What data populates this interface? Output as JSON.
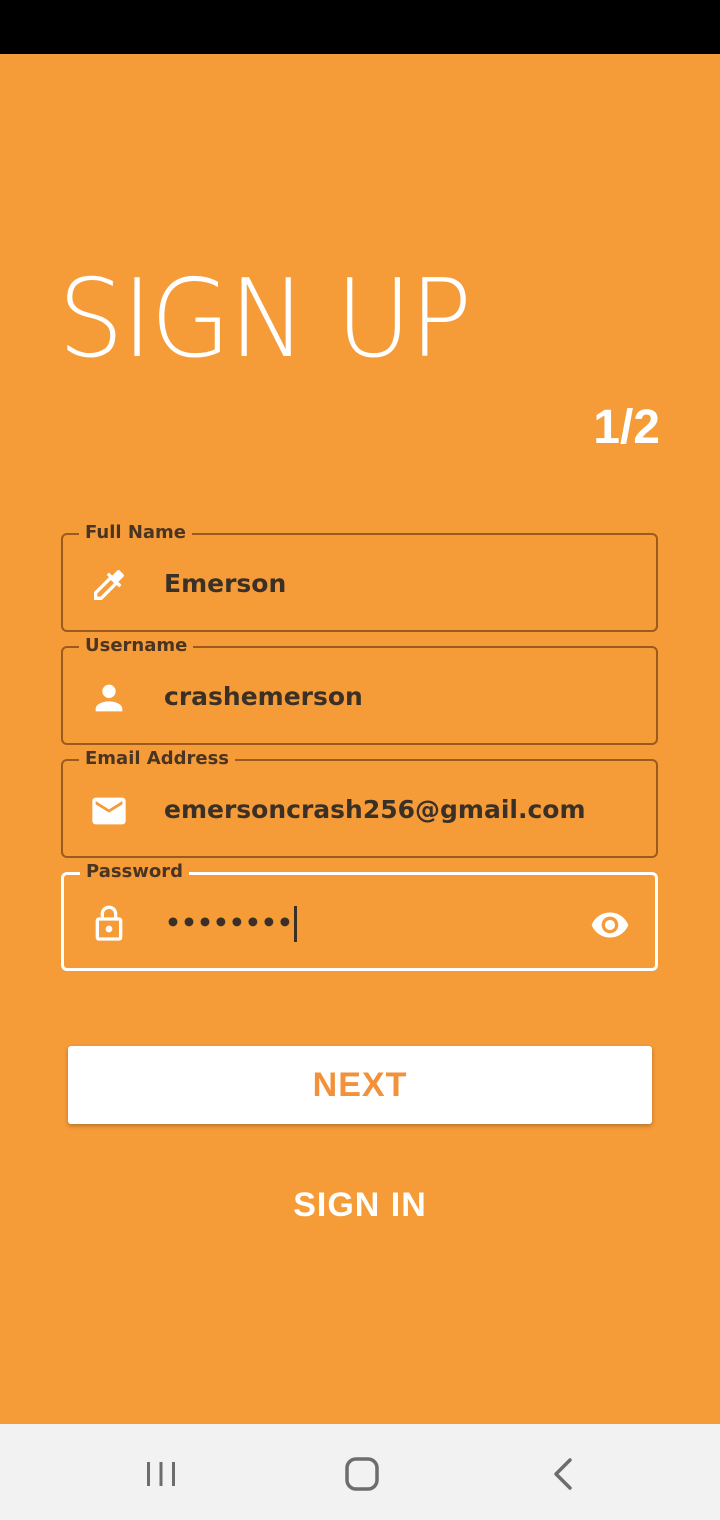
{
  "header": {
    "title": "SIGN UP",
    "step": "1/2"
  },
  "fields": [
    {
      "label": "Full Name",
      "value": "Emerson",
      "icon": "pen-icon"
    },
    {
      "label": "Username",
      "value": "crashemerson",
      "icon": "person-icon"
    },
    {
      "label": "Email Address",
      "value": "emersoncrash256@gmail.com",
      "icon": "mail-icon"
    },
    {
      "label": "Password",
      "value": "••••••••",
      "icon": "lock-icon",
      "trailing_icon": "eye-icon"
    }
  ],
  "actions": {
    "next_label": "NEXT",
    "signin_label": "SIGN IN"
  },
  "nav": {
    "recent": "recent-apps-icon",
    "home": "home-icon",
    "back": "back-icon"
  },
  "colors": {
    "background": "#f59b38",
    "accent": "#f2913a",
    "text_dark": "#3b3026"
  }
}
